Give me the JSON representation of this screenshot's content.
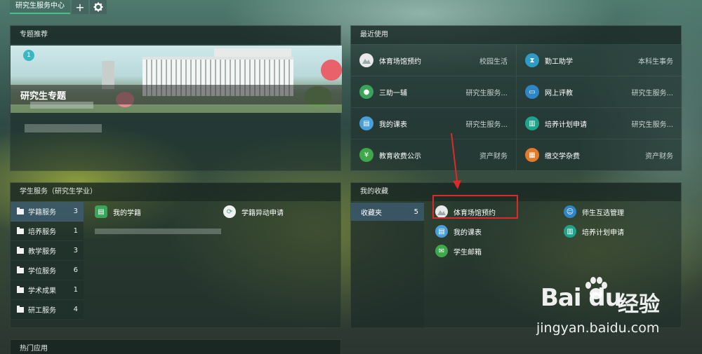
{
  "topbar": {
    "home_tab": "研究生服务中心",
    "add_icon": "plus-icon",
    "settings_icon": "gear-icon"
  },
  "featured": {
    "header": "专题推荐",
    "slide_number": "1",
    "title": "研究生专题"
  },
  "recent": {
    "header": "最近使用",
    "items": [
      {
        "name": "体育场馆预约",
        "category": "校园生活",
        "icon": "sports-venue-icon",
        "color": "#e9e9e9"
      },
      {
        "name": "勤工助学",
        "category": "本科生事务",
        "icon": "hourglass-icon",
        "color": "#2e9ac6"
      },
      {
        "name": "三助一辅",
        "category": "研究生服务...",
        "icon": "person-icon",
        "color": "#3aa55a"
      },
      {
        "name": "网上评教",
        "category": "研究生服务...",
        "icon": "monitor-icon",
        "color": "#2e86c6"
      },
      {
        "name": "我的课表",
        "category": "研究生服务...",
        "icon": "document-icon",
        "color": "#4a9fd8"
      },
      {
        "name": "培养计划申请",
        "category": "研究生服务...",
        "icon": "clipboard-icon",
        "color": "#1fa38a"
      },
      {
        "name": "教育收费公示",
        "category": "资产财务",
        "icon": "money-icon",
        "color": "#3fa84a"
      },
      {
        "name": "缴交学杂费",
        "category": "资产财务",
        "icon": "calculator-icon",
        "color": "#e27a2a"
      }
    ]
  },
  "services": {
    "header": "学生服务（研究生学业）",
    "folders": [
      {
        "label": "学籍服务",
        "count": "3"
      },
      {
        "label": "培养服务",
        "count": "1"
      },
      {
        "label": "教学服务",
        "count": "3"
      },
      {
        "label": "学位服务",
        "count": "6"
      },
      {
        "label": "学术成果",
        "count": "1"
      },
      {
        "label": "研工服务",
        "count": "4"
      }
    ],
    "links": [
      {
        "name": "我的学籍",
        "icon": "student-record-icon"
      },
      {
        "name": "学籍异动申请",
        "icon": "record-change-icon"
      }
    ]
  },
  "favorites": {
    "header": "我的收藏",
    "folder": {
      "label": "收藏夹",
      "count": "5"
    },
    "items": [
      {
        "name": "体育场馆预约",
        "icon": "sports-venue-icon"
      },
      {
        "name": "师生互选管理",
        "icon": "teacher-student-icon"
      },
      {
        "name": "我的课表",
        "icon": "document-icon"
      },
      {
        "name": "培养计划申请",
        "icon": "clipboard-icon"
      },
      {
        "name": "学生邮箱",
        "icon": "mail-icon"
      }
    ]
  },
  "hot": {
    "header": "热门应用"
  },
  "watermark": {
    "logo": "Bai du",
    "cn": "经验",
    "url": "jingyan.baidu.com"
  }
}
